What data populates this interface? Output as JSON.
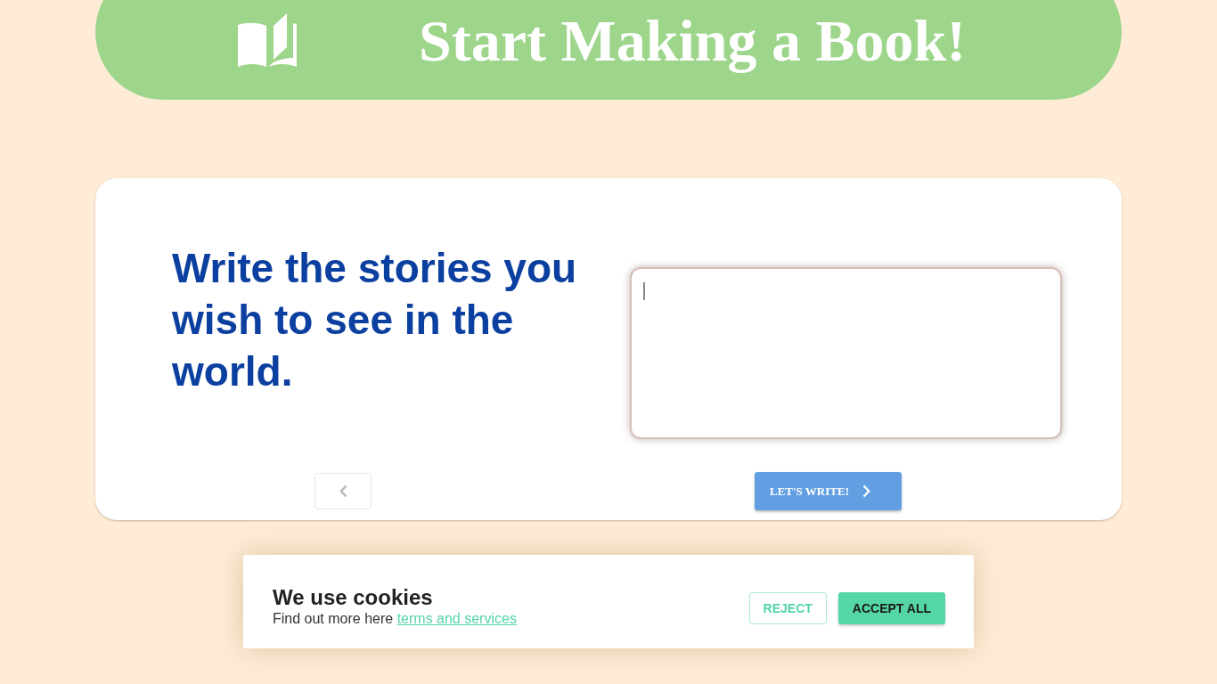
{
  "header": {
    "title": "Start Making a Book!"
  },
  "intro": {
    "heading": "Write the stories you wish to see in the world."
  },
  "story_field": {
    "focused": true
  },
  "next_button": {
    "label": "LET'S WRITE!"
  },
  "cookie_banner": {
    "title": "We use cookies",
    "text": "Find out more here",
    "link": "terms and services",
    "buttons": [
      {
        "label": "REJECT",
        "kind": "outline"
      },
      {
        "label": "ACCEPT ALL",
        "kind": "filled"
      }
    ]
  }
}
